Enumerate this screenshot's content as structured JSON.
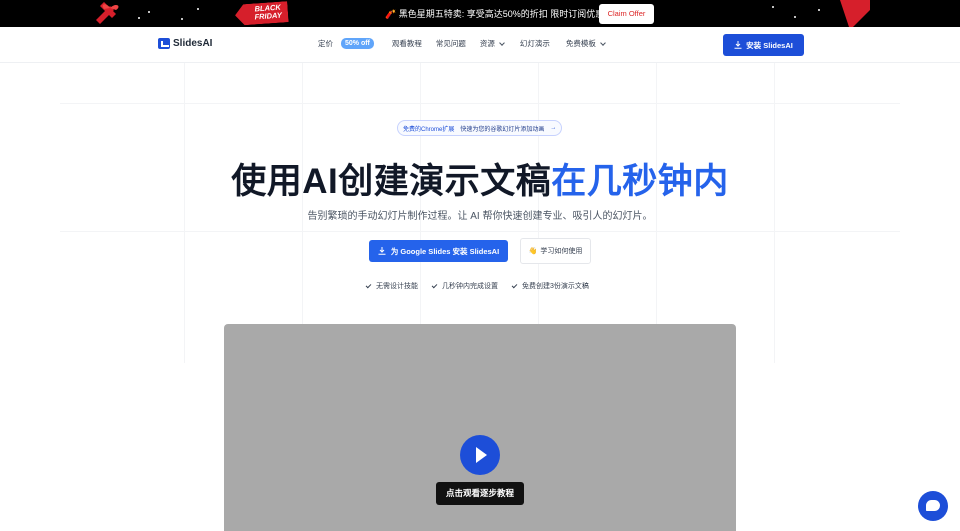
{
  "promo": {
    "tag_line1": "BLACK",
    "tag_line2": "FRIDAY",
    "message": "🧨 黑色星期五特卖: 享受高达50%的折扣 限时订阅优惠 👜",
    "claim_button": "Claim Offer"
  },
  "nav": {
    "logo": "SlidesAI",
    "pricing": "定价",
    "pricing_badge": "50% off",
    "tutorials": "观看教程",
    "faq": "常见问题",
    "resources": "资源",
    "presentations": "幻灯演示",
    "templates": "免费模板",
    "install": "安装 SlidesAI"
  },
  "hero": {
    "pill_left": "免费的Chrome扩展",
    "pill_right": "快速为您的谷歌幻灯片添加动画",
    "pill_arrow": "→",
    "headline_main": "使用AI创建演示文稿",
    "headline_accent": "在几秒钟内",
    "subtitle": "告别繁琐的手动幻灯片制作过程。让 AI 帮你快速创建专业、吸引人的幻灯片。",
    "cta_primary": "为 Google Slides 安装 SlidesAI",
    "cta_secondary_emoji": "👋",
    "cta_secondary": "学习如何使用",
    "features": [
      "无需设计技能",
      "几秒钟内完成设置",
      "免费创建3份演示文稿"
    ]
  },
  "video": {
    "label": "点击观看逐步教程"
  },
  "colors": {
    "brand": "#1d4ed8",
    "accent": "#2563eb",
    "promo_bg": "#000000",
    "tag_red": "#d61f2b"
  }
}
